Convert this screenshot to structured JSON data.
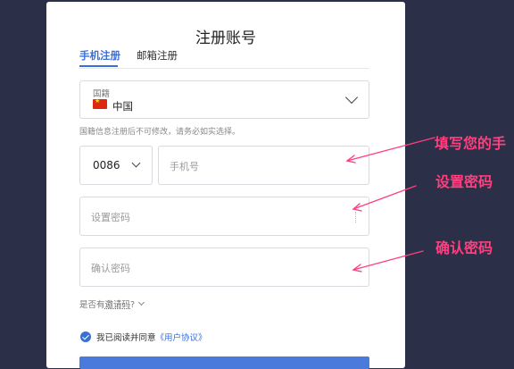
{
  "page": {
    "title": "注册账号",
    "tabs": [
      {
        "label": "手机注册",
        "active": true
      },
      {
        "label": "邮箱注册",
        "active": false
      }
    ]
  },
  "country": {
    "label": "国籍",
    "value": "中国",
    "hint": "国籍信息注册后不可修改，请务必如实选择。"
  },
  "phone": {
    "code": "0086",
    "placeholder": "手机号"
  },
  "password": {
    "placeholder": "设置密码"
  },
  "confirm": {
    "placeholder": "确认密码"
  },
  "invite": {
    "prefix": "是否有",
    "link": "邀请码",
    "suffix": "?"
  },
  "agreement": {
    "text": "我已阅读并同意",
    "link": "《用户协议》"
  },
  "annotations": {
    "phone": "填写您的手",
    "password": "设置密码",
    "confirm": "确认密码"
  },
  "colors": {
    "accent": "#3a6fd8",
    "annotation": "#ff3f7f",
    "background": "#2b2f47"
  }
}
